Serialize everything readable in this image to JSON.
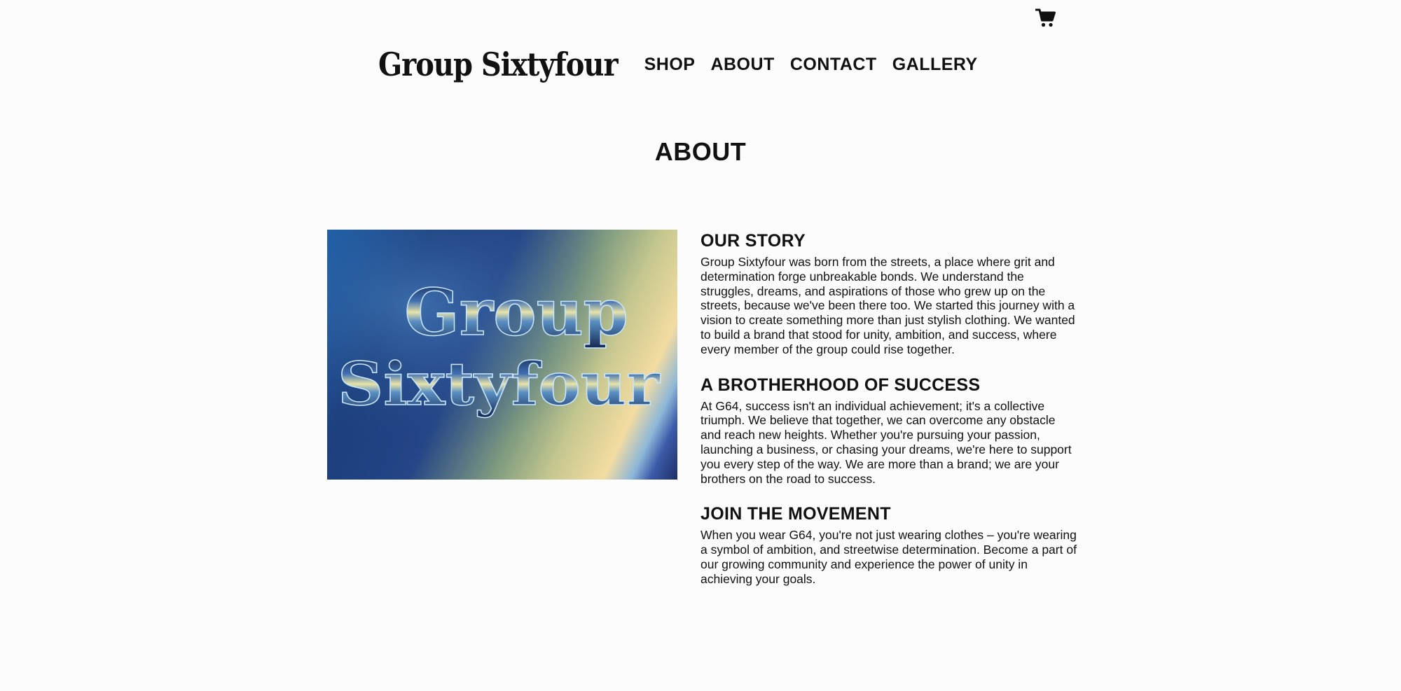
{
  "header": {
    "logo_text": "Group Sixtyfour",
    "nav": [
      {
        "label": "SHOP"
      },
      {
        "label": "ABOUT"
      },
      {
        "label": "CONTACT"
      },
      {
        "label": "GALLERY"
      }
    ],
    "cart_icon": "shopping-cart-icon"
  },
  "page": {
    "title": "ABOUT"
  },
  "hero": {
    "line1": "Group",
    "line2": "Sixtyfour"
  },
  "sections": [
    {
      "heading": "OUR STORY",
      "body": "Group Sixtyfour was born from the streets, a place where grit and determination forge unbreakable bonds. We understand the struggles, dreams, and aspirations of those who grew up on the streets, because we've been there too. We started this journey with a vision to create something more than just stylish clothing. We wanted to build a brand that stood for unity, ambition, and success, where every member of the group could rise together."
    },
    {
      "heading": "A BROTHERHOOD OF SUCCESS",
      "body": "At G64, success isn't an individual achievement; it's a collective triumph. We believe that together, we can overcome any obstacle and reach new heights. Whether you're pursuing your passion, launching a business, or chasing your dreams, we're here to support you every step of the way. We are more than a brand; we are your brothers on the road to success."
    },
    {
      "heading": "JOIN THE MOVEMENT",
      "body": "When you wear G64, you're not just wearing clothes – you're wearing a symbol of ambition, and streetwise determination. Become a part of our growing community and experience the power of unity in achieving your goals."
    }
  ],
  "colors": {
    "background": "#fcfcfc",
    "text": "#111111"
  }
}
